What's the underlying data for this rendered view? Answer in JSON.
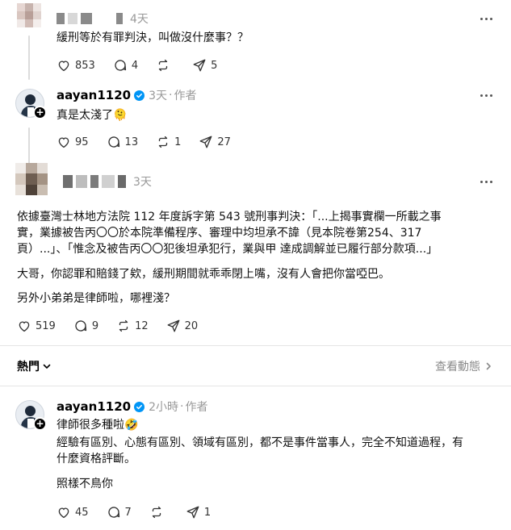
{
  "posts": [
    {
      "name_visible": "",
      "time": "4天",
      "text": "緩刑等於有罪判決，叫做沒什麼事？？",
      "likes": "853",
      "comments": "4",
      "reposts": "",
      "shares": "5"
    },
    {
      "username": "aayan1120",
      "time": "3天",
      "author_tag": "作者",
      "text": "真是太淺了🫠",
      "likes": "95",
      "comments": "13",
      "reposts": "1",
      "shares": "27"
    },
    {
      "time": "3天",
      "paragraphs": [
        "依據臺灣士林地方法院 112 年度訴字第 543 號刑事判決：「...上揭事實欄一所載之事",
        "實，業據被告丙〇〇於本院準備程序、審理中均坦承不諱（見本院卷第254、317",
        "頁）...」、「惟念及被告丙〇〇犯後坦承犯行，業與甲 達成調解並已履行部分款項...」",
        "大哥，你認罪和賠錢了欸，緩刑期間就乖乖閉上嘴，沒有人會把你當啞巴。",
        "另外小弟弟是律師啦，哪裡淺？"
      ],
      "likes": "519",
      "comments": "9",
      "reposts": "12",
      "shares": "20"
    },
    {
      "username": "aayan1120",
      "time": "2小時",
      "author_tag": "作者",
      "paragraphs": [
        "律師很多種啦🤣",
        "經驗有區別、心態有區別、領域有區別，都不是事件當事人，完全不知道過程，有",
        "什麼資格評斷。",
        "照樣不鳥你"
      ],
      "likes": "45",
      "comments": "7",
      "reposts": "",
      "shares": "1"
    }
  ],
  "sort": {
    "label": "熱門",
    "view_activity": "查看動態"
  },
  "colors": {
    "verified": "#0095f6",
    "muted": "#999999",
    "divider": "#e5e5e5"
  }
}
